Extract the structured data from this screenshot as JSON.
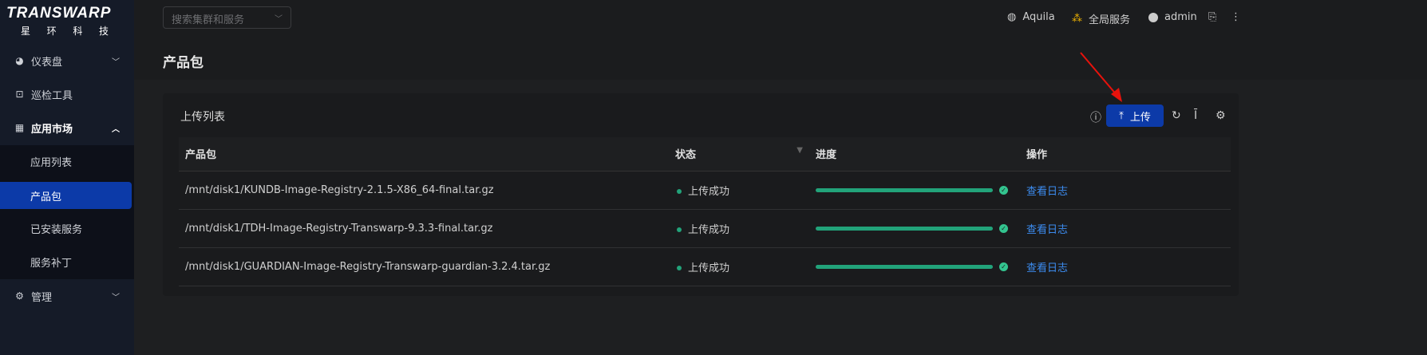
{
  "logo": {
    "brand": "TRANSWARP",
    "cn": [
      "星",
      "环",
      "科",
      "技"
    ]
  },
  "sidebar": {
    "items": [
      {
        "label": "仪表盘",
        "icon": "dashboard-icon"
      },
      {
        "label": "巡检工具",
        "icon": "toolbox-icon"
      },
      {
        "label": "应用市场",
        "icon": "apps-icon"
      },
      {
        "label": "管理",
        "icon": "gear-icon"
      }
    ],
    "sub_items": [
      "应用列表",
      "产品包",
      "已安装服务",
      "服务补丁"
    ]
  },
  "header": {
    "search_placeholder": "搜索集群和服务",
    "cluster": "Aquila",
    "global": "全局服务",
    "user": "admin"
  },
  "page": {
    "title": "产品包"
  },
  "card": {
    "title": "上传列表",
    "upload_label": "上传",
    "columns": [
      "产品包",
      "状态",
      "进度",
      "操作"
    ],
    "rows": [
      {
        "file": "/mnt/disk1/KUNDB-Image-Registry-2.1.5-X86_64-final.tar.gz",
        "status": "上传成功",
        "progress": 100,
        "action": "查看日志"
      },
      {
        "file": "/mnt/disk1/TDH-Image-Registry-Transwarp-9.3.3-final.tar.gz",
        "status": "上传成功",
        "progress": 100,
        "action": "查看日志"
      },
      {
        "file": "/mnt/disk1/GUARDIAN-Image-Registry-Transwarp-guardian-3.2.4.tar.gz",
        "status": "上传成功",
        "progress": 100,
        "action": "查看日志"
      }
    ]
  },
  "colors": {
    "accent": "#0c3aa8",
    "success": "#22a37a",
    "link": "#3c8cf0"
  }
}
